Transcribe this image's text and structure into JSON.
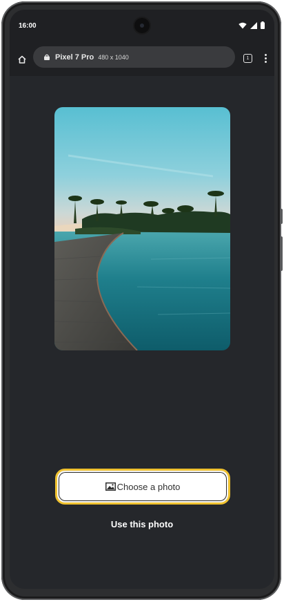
{
  "status_bar": {
    "time": "16:00",
    "icons": [
      "wifi-icon",
      "signal-icon",
      "battery-icon"
    ]
  },
  "browser": {
    "device_name": "Pixel 7 Pro",
    "viewport": "480 x 1040",
    "tab_count": "1",
    "icons": [
      "home-icon",
      "lock-icon",
      "more-vert-icon"
    ]
  },
  "main": {
    "image_alt": "",
    "choose_button_label": "Choose a photo",
    "choose_button_icon": "image-icon",
    "use_photo_label": "Use this photo"
  },
  "colors": {
    "screen_bg": "#25272b",
    "accent_border": "#f0c230"
  }
}
